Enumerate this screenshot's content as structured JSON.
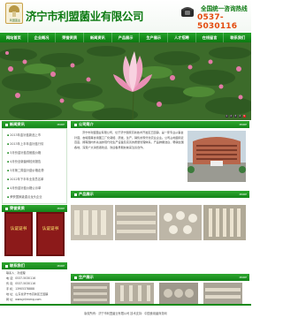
{
  "header": {
    "company_name": "济宁市利盟菌业有限公司",
    "logo_text": "利盟菌业",
    "hotline_label": "全国统一咨询热线",
    "hotline_number": "0537-5030116"
  },
  "nav": [
    "网站首页",
    "企业概况",
    "荣誉资质",
    "新闻资讯",
    "产品展示",
    "生产展示",
    "人才招聘",
    "在线留言",
    "联系我们"
  ],
  "banner": {
    "slides": [
      "1",
      "2",
      "3",
      "4",
      "5"
    ],
    "active_slide": 5
  },
  "news": {
    "title": "新闻资讯",
    "more": "MORE",
    "items": [
      "2013年金针菇新品上市",
      "2013年上半年金针菇行情",
      "3月份金针菇杏鲍菇价格",
      "4月份全新菌种检测报告",
      "3月第二周金针菇价格走势",
      "2012年下半年业务员名单",
      "4月份金针菇价格公示单",
      "荣获国家级重点龙头企业"
    ]
  },
  "about": {
    "title": "公司简介",
    "more": "MORE",
    "text": "济宁市利盟菌业有限公司，位于济宁国家高新技术开发区王因镇，是一家专业从事金针菇、杏鲍菇等食用菌工厂化栽培、研发、生产、销售的现代化农业企业。公司占地面积近百亩，拥有国内外先进的现代化生产设备及完善的质量管理体系。产品鲜嫩洁白，畅销全国各地，深受广大消费者欢迎，欢迎各界朋友前来洽谈合作。"
  },
  "honor": {
    "title": "荣誉资质",
    "more": "MORE",
    "cert_text": "认证证书"
  },
  "products": {
    "title": "产品展示",
    "more": "MORE"
  },
  "contact": {
    "title": "联系我们",
    "more": "MORE",
    "lines": [
      "联系人：孙经理",
      "电  话：0537-5030116",
      "传  真：0537-5030116",
      "手  机：13905378888",
      "地  址：山东省济宁市高新区王因镇",
      "网  址：www.jnlimeng.com"
    ]
  },
  "production": {
    "title": "生产展示",
    "more": "MORE"
  },
  "footer": {
    "text": "版权所有：济宁市利盟菌业有限公司  技术支持：中国食用菌商务网"
  },
  "colors": {
    "brand_green": "#0d7a12",
    "hotline_orange": "#e34a0d",
    "nav_green": "#14851a"
  }
}
